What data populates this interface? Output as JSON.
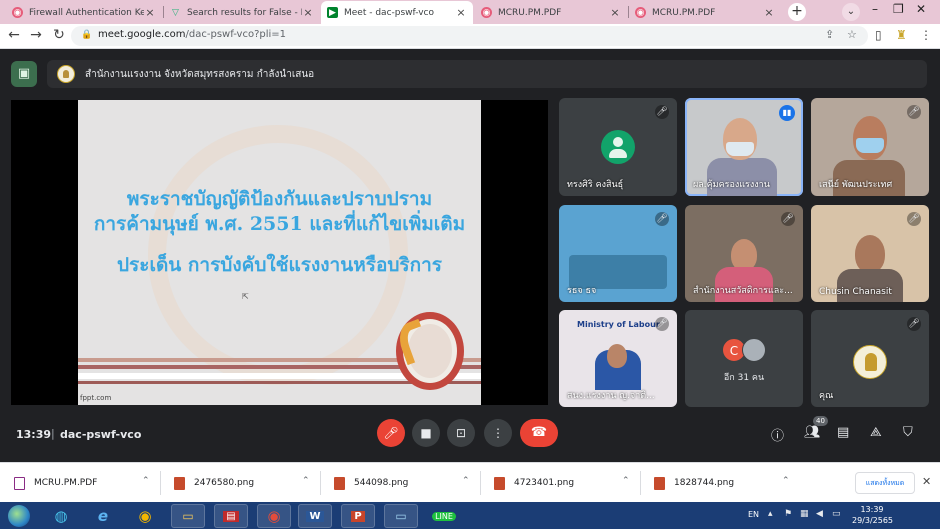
{
  "browser": {
    "tabs": [
      {
        "title": "Firewall Authentication Keepal",
        "icon": "chrome-circle-icon",
        "active": false
      },
      {
        "title": "Search results for False - Flatic",
        "icon": "flaticon-icon",
        "active": false
      },
      {
        "title": "Meet - dac-pswf-vco",
        "icon": "meet-icon",
        "active": true
      },
      {
        "title": "MCRU.PM.PDF",
        "icon": "chrome-circle-icon",
        "active": false
      },
      {
        "title": "MCRU.PM.PDF",
        "icon": "chrome-circle-icon",
        "active": false
      }
    ],
    "tab_close": "×",
    "new_tab": "+",
    "url_host": "meet.google.com",
    "url_path": "/dac-pswf-vco?pli=1"
  },
  "meet": {
    "presenter_text": "สำนักงานแรงงาน จังหวัดสมุทรสงคราม กำลังนำเสนอ",
    "slide": {
      "line1": "พระราชบัญญัติป้องกันและปราบปราม",
      "line2": "การค้ามนุษย์ พ.ศ. 2551 และที่แก้ไขเพิ่มเติม",
      "line3": "ประเด็น การบังคับใช้แรงงานหรือบริการ",
      "footer": "fppt.com"
    },
    "tiles": [
      {
        "name": "ทรงศิริ คงสินธุ์"
      },
      {
        "name": "ผล.คุ้มครองแรงงาน"
      },
      {
        "name": "เสนีย์ พัฒนประเทศ"
      },
      {
        "name": "รธจ ธจ"
      },
      {
        "name": "สำนักงานสวัสดิการและ..."
      },
      {
        "name": "Chusin Chanasit"
      },
      {
        "name": "สนง.แรงงาน ญ.จาติ..."
      },
      {
        "name": "อีก 31 คน",
        "initial": "C"
      },
      {
        "name": "คุณ"
      }
    ],
    "slide_tile_text": "Ministry of Labour",
    "time": "13:39",
    "separator": "|",
    "meeting_code": "dac-pswf-vco",
    "people_count": "40"
  },
  "downloads": {
    "items": [
      {
        "name": "MCRU.PM.PDF",
        "type": "pdf"
      },
      {
        "name": "2476580.png",
        "type": "png"
      },
      {
        "name": "544098.png",
        "type": "png"
      },
      {
        "name": "4723401.png",
        "type": "png"
      },
      {
        "name": "1828744.png",
        "type": "png"
      }
    ],
    "show_all": "แสดงทั้งหมด"
  },
  "taskbar": {
    "language": "EN",
    "clock_time": "13:39",
    "clock_date": "29/3/2565"
  },
  "colors": {
    "accent": "#1a73e8",
    "danger": "#ea4335",
    "meet_bg": "#202124",
    "slide_text": "#3aa6df",
    "tabbar": "#e8c7d6",
    "taskbar": "#1b3d75"
  }
}
